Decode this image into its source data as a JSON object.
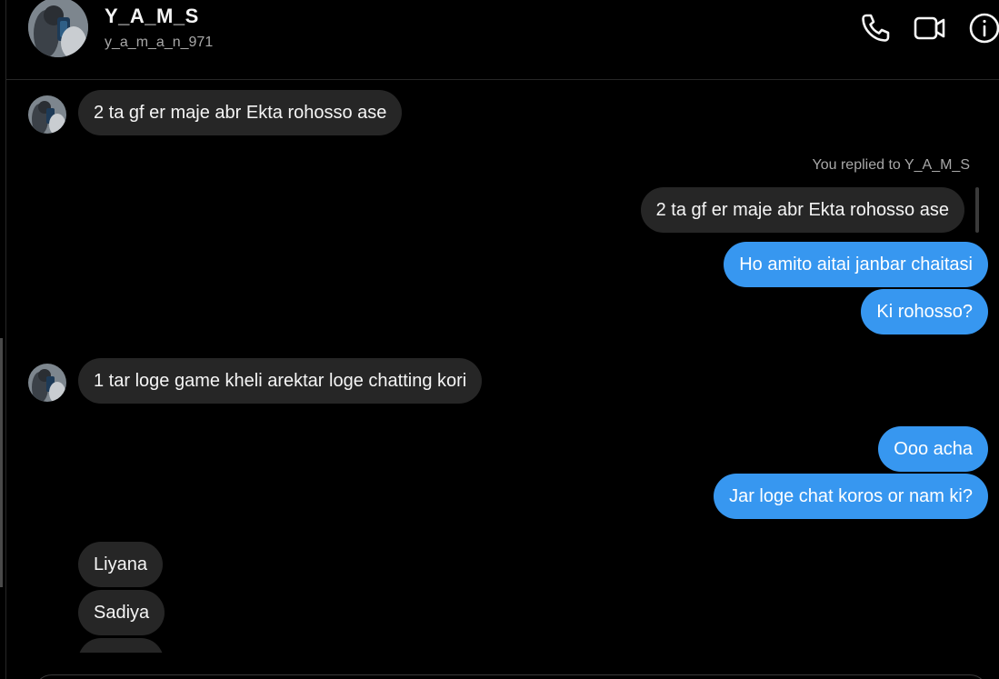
{
  "header": {
    "name": "Y_A_M_S",
    "username": "y_a_m_a_n_971",
    "icons": [
      "phone-icon",
      "video-camera-icon",
      "info-icon"
    ]
  },
  "messages": [
    {
      "side": "incoming",
      "text": "2 ta gf er maje abr Ekta rohosso ase"
    },
    {
      "side": "outgoing",
      "reply_label": "You replied to Y_A_M_S",
      "quoted_text": "2 ta gf er maje abr Ekta rohosso ase"
    },
    {
      "side": "outgoing",
      "text": "Ho amito aitai janbar chaitasi"
    },
    {
      "side": "outgoing",
      "text": "Ki rohosso?"
    },
    {
      "side": "incoming",
      "text": "1 tar loge game kheli arektar loge chatting kori"
    },
    {
      "side": "outgoing",
      "text": "Ooo acha"
    },
    {
      "side": "outgoing",
      "text": "Jar loge chat koros or nam ki?"
    },
    {
      "side": "incoming",
      "text": "Liyana"
    },
    {
      "side": "incoming",
      "text": "Sadiya"
    }
  ],
  "colors": {
    "background": "#000000",
    "incoming_bubble": "#262626",
    "outgoing_bubble": "#3797f0",
    "secondary_text": "#a8a8a8"
  }
}
